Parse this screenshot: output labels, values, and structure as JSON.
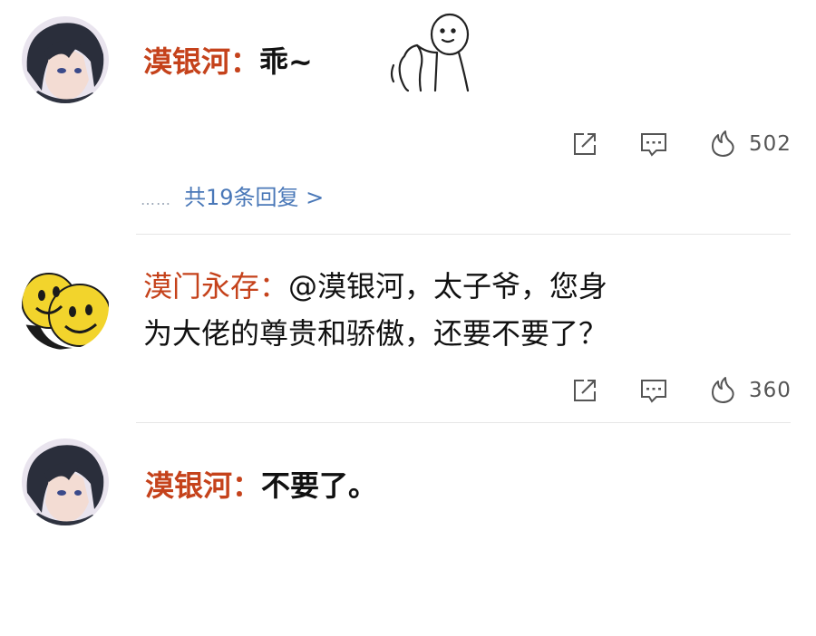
{
  "comments": [
    {
      "name": "漠银河：",
      "text": "乖~",
      "likes": "502",
      "replies_dots": "……",
      "replies_label": "共19条回复 >"
    },
    {
      "name": "漠门永存：",
      "text_line1": "@漠银河，太子爷，您身",
      "text_line2": "为大佬的尊贵和骄傲，还要不要了？",
      "likes": "360"
    },
    {
      "name": "漠银河：",
      "text": "不要了。"
    }
  ],
  "icons": {
    "share": "share-icon",
    "comment": "comment-icon",
    "like": "fire-icon"
  },
  "colors": {
    "name": "#c5421b",
    "link": "#4a78b8",
    "text": "#111111",
    "meta": "#555555"
  }
}
